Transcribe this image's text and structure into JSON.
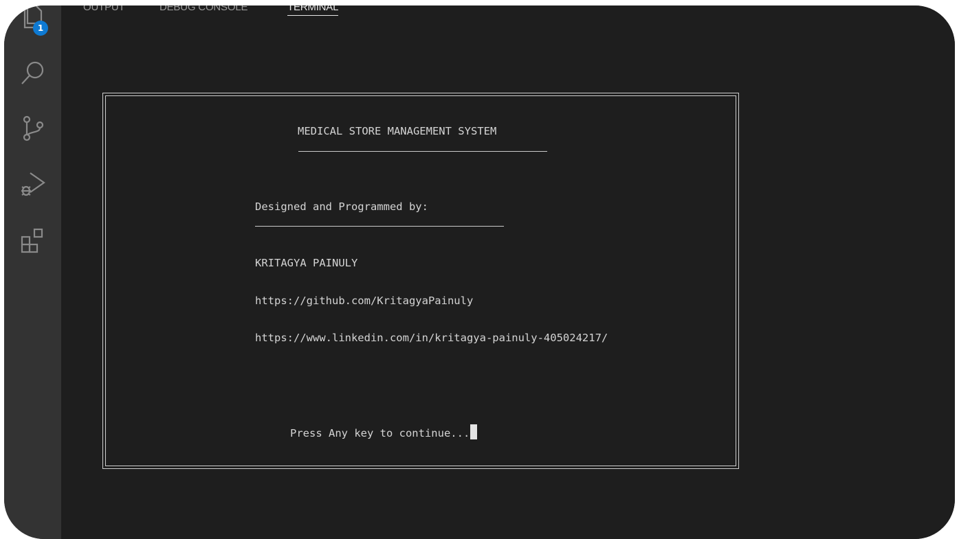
{
  "activity_bar": {
    "items": [
      {
        "name": "explorer-icon",
        "badge": "1"
      },
      {
        "name": "search-icon"
      },
      {
        "name": "source-control-icon"
      },
      {
        "name": "run-debug-icon"
      },
      {
        "name": "extensions-icon"
      }
    ]
  },
  "panel": {
    "tabs": [
      {
        "label": "OUTPUT",
        "active": false
      },
      {
        "label": "DEBUG CONSOLE",
        "active": false
      },
      {
        "label": "TERMINAL",
        "active": true
      }
    ]
  },
  "terminal": {
    "title": "MEDICAL STORE MANAGEMENT SYSTEM",
    "designed_by_label": "Designed and Programmed by:",
    "author": "KRITAGYA PAINULY",
    "github": "https://github.com/KritagyaPainuly",
    "linkedin": "https://www.linkedin.com/in/kritagya-painuly-405024217/",
    "prompt": "Press Any key to continue..."
  },
  "colors": {
    "background": "#1e1e1e",
    "activity_bar": "#333333",
    "badge": "#0e7ad3",
    "text": "#d4d4d4"
  }
}
